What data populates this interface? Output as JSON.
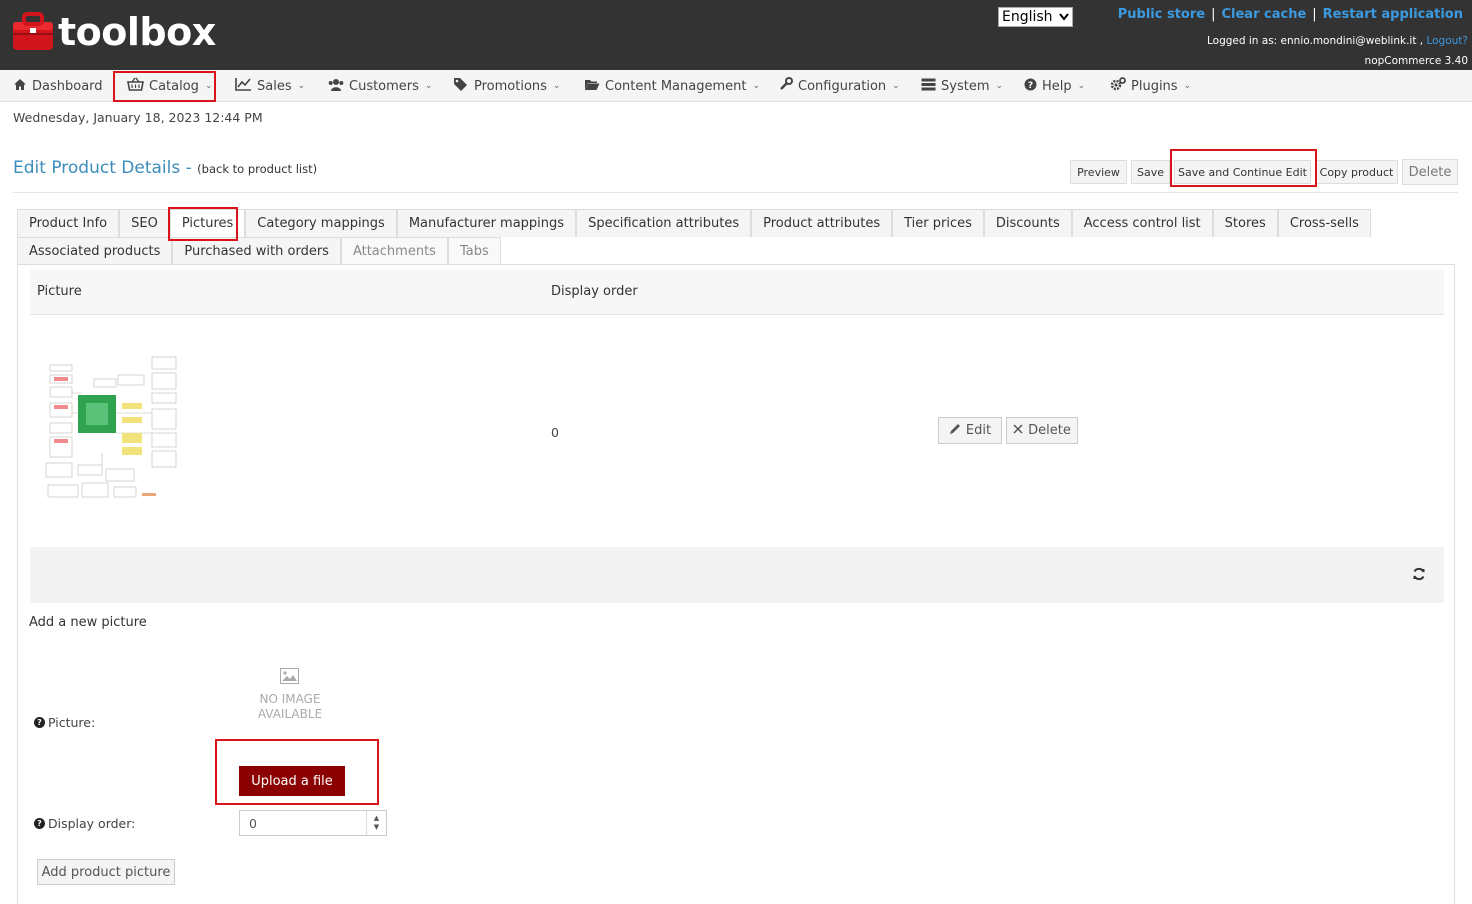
{
  "app": {
    "name": "toolbox"
  },
  "header": {
    "language": "English",
    "links": [
      "Public store",
      "Clear cache",
      "Restart application"
    ],
    "logged_prefix": "Logged in as: ennio.mondini@weblink.it ,",
    "logout": "Logout?",
    "version": "nopCommerce 3.40"
  },
  "nav": {
    "items": [
      {
        "label": "Dashboard",
        "icon": "home-icon"
      },
      {
        "label": "Catalog",
        "icon": "basket-icon"
      },
      {
        "label": "Sales",
        "icon": "chart-line-icon"
      },
      {
        "label": "Customers",
        "icon": "users-icon"
      },
      {
        "label": "Promotions",
        "icon": "tags-icon"
      },
      {
        "label": "Content Management",
        "icon": "folder-open-icon"
      },
      {
        "label": "Configuration",
        "icon": "wrench-icon"
      },
      {
        "label": "System",
        "icon": "server-icon"
      },
      {
        "label": "Help",
        "icon": "question-circle-icon"
      },
      {
        "label": "Plugins",
        "icon": "cogs-icon"
      }
    ]
  },
  "date": "Wednesday, January 18, 2023 12:44 PM",
  "page": {
    "title": "Edit Product Details -",
    "back": "(back to product list)"
  },
  "actions": {
    "preview": "Preview",
    "save": "Save",
    "save_continue": "Save and Continue Edit",
    "copy": "Copy product",
    "delete": "Delete"
  },
  "tabs": {
    "row1": [
      "Product Info",
      "SEO",
      "Pictures",
      "Category mappings",
      "Manufacturer mappings",
      "Specification attributes",
      "Product attributes",
      "Tier prices",
      "Discounts",
      "Access control list",
      "Stores",
      "Cross-sells"
    ],
    "row2": [
      "Associated products",
      "Purchased with orders",
      "Attachments",
      "Tabs"
    ],
    "active": "Pictures"
  },
  "grid": {
    "col_picture": "Picture",
    "col_order": "Display order",
    "row_order": "0",
    "edit": "Edit",
    "delete": "Delete"
  },
  "add": {
    "title": "Add a new picture",
    "picture_label": "Picture:",
    "no_image_1": "NO IMAGE",
    "no_image_2": "AVAILABLE",
    "upload": "Upload a file",
    "order_label": "Display order:",
    "order_value": "0",
    "add_button": "Add product picture"
  },
  "colors": {
    "header_bg": "#333333",
    "link": "#3c9ae0",
    "title": "#3c8dbc",
    "highlight": "#d9141b",
    "upload_bg": "#8b0000"
  }
}
